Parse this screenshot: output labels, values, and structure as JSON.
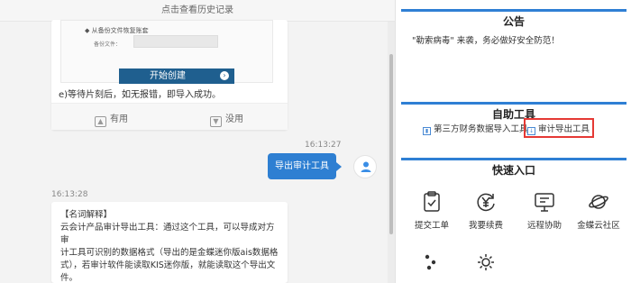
{
  "chat": {
    "history_link": "点击查看历史记录",
    "screenshot": {
      "line1": "◆ 从备份文件恢复账套",
      "field_label": "备份文件：",
      "start_button": "开始创建",
      "start_icon": "›"
    },
    "step_text": "e)等待片刻后，如无报错，即导入成功。",
    "feedback": {
      "useful": "有用",
      "useless": "没用"
    },
    "time_user": "16:13:27",
    "user_message": "导出审计工具",
    "time_bot": "16:13:28",
    "bot_reply": {
      "term_heading": "【名词解释】",
      "lines": [
        "云会计产品审计导出工具：通过这个工具，可以导成对方审",
        "计工具可识别的数据格式（导出的是金蝶迷你版ais数据格",
        "式），若审计软件能读取KIS迷你版，就能读取这个导出文",
        "件。"
      ]
    }
  },
  "panel": {
    "notice": {
      "title": "公告",
      "text": "\"勒索病毒\" 来袭，务必做好安全防范！"
    },
    "tools": {
      "title": "自助工具",
      "items": [
        {
          "label": "第三方财务数据导入工具",
          "icon": "chart-icon"
        },
        {
          "label": "审计导出工具",
          "icon": "document-export-icon"
        }
      ],
      "highlight_color": "#e53935"
    },
    "quick": {
      "title": "快速入口",
      "items": [
        {
          "label": "提交工单",
          "icon": "clipboard-icon"
        },
        {
          "label": "我要续费",
          "icon": "yen-refresh-icon"
        },
        {
          "label": "远程协助",
          "icon": "monitor-icon"
        },
        {
          "label": "金蝶云社区",
          "icon": "planet-icon"
        },
        {
          "label": "",
          "icon": "dots-icon"
        },
        {
          "label": "",
          "icon": "settings-icon"
        }
      ]
    }
  },
  "colors": {
    "accent": "#2f7fd4",
    "user_bubble": "#2e7fd2"
  }
}
